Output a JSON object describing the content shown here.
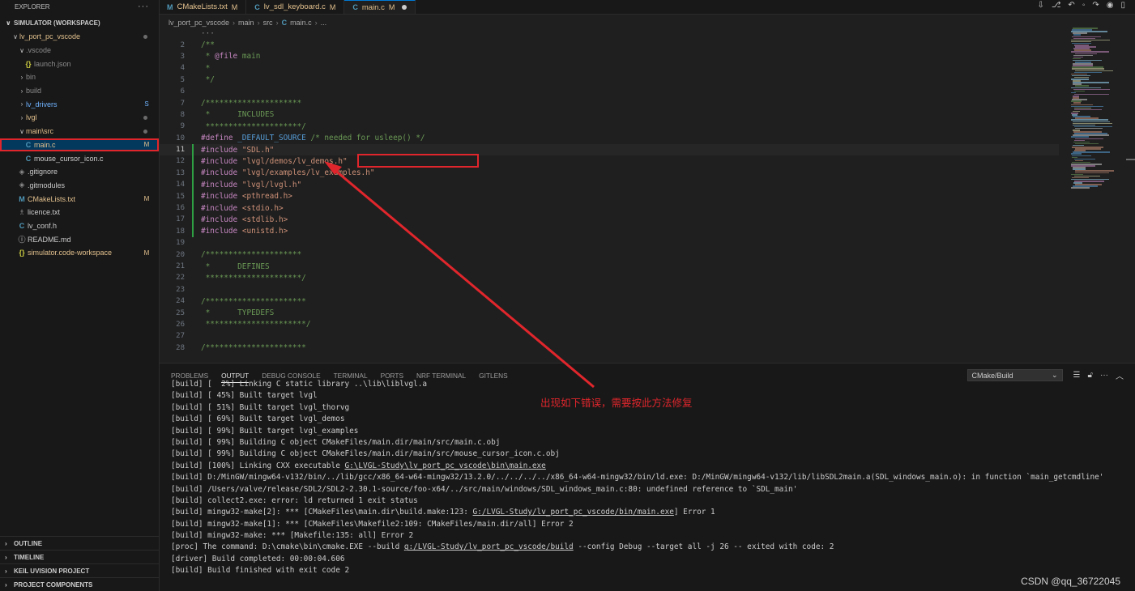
{
  "sidebar": {
    "header": "EXPLORER",
    "more": "···",
    "workspace": "SIMULATOR (WORKSPACE)",
    "items": [
      {
        "chev": "∨",
        "icon": "",
        "label": "lv_port_pc_vscode",
        "mark": "dot",
        "indent": 14
      },
      {
        "chev": "∨",
        "icon": "",
        "label": ".vscode",
        "mark": "",
        "indent": 22,
        "dim": true
      },
      {
        "chev": "",
        "icon": "{}",
        "label": "launch.json",
        "mark": "",
        "indent": 28,
        "dim": true
      },
      {
        "chev": "›",
        "icon": "",
        "label": "bin",
        "mark": "",
        "indent": 22,
        "dim": true
      },
      {
        "chev": "›",
        "icon": "",
        "label": "build",
        "mark": "",
        "indent": 22,
        "dim": true
      },
      {
        "chev": "›",
        "icon": "",
        "label": "lv_drivers",
        "mark": "S",
        "indent": 22
      },
      {
        "chev": "›",
        "icon": "",
        "label": "lvgl",
        "mark": "dot",
        "indent": 22
      },
      {
        "chev": "∨",
        "icon": "",
        "label": "main\\src",
        "mark": "dot",
        "indent": 22
      },
      {
        "chev": "",
        "icon": "C",
        "label": "main.c",
        "mark": "M",
        "indent": 28,
        "selected": true
      },
      {
        "chev": "",
        "icon": "C",
        "label": "mouse_cursor_icon.c",
        "mark": "",
        "indent": 28
      },
      {
        "chev": "",
        "icon": "◈",
        "label": ".gitignore",
        "mark": "",
        "indent": 20
      },
      {
        "chev": "",
        "icon": "◈",
        "label": ".gitmodules",
        "mark": "",
        "indent": 20
      },
      {
        "chev": "",
        "icon": "M",
        "label": "CMakeLists.txt",
        "mark": "M",
        "indent": 20
      },
      {
        "chev": "",
        "icon": "♗",
        "label": "licence.txt",
        "mark": "",
        "indent": 20
      },
      {
        "chev": "",
        "icon": "C",
        "label": "lv_conf.h",
        "mark": "",
        "indent": 20
      },
      {
        "chev": "",
        "icon": "ⓘ",
        "label": "README.md",
        "mark": "",
        "indent": 20
      },
      {
        "chev": "",
        "icon": "{}",
        "label": "simulator.code-workspace",
        "mark": "M",
        "indent": 20
      }
    ],
    "bottom_sections": [
      "OUTLINE",
      "TIMELINE",
      "KEIL UVISION PROJECT",
      "PROJECT COMPONENTS"
    ]
  },
  "tabs": [
    {
      "icon": "M",
      "label": "CMakeLists.txt",
      "badge": "M"
    },
    {
      "icon": "C",
      "label": "lv_sdl_keyboard.c",
      "badge": "M"
    },
    {
      "icon": "C",
      "label": "main.c",
      "badge": "M",
      "active": true
    }
  ],
  "breadcrumb": [
    "lv_port_pc_vscode",
    "main",
    "src",
    "main.c",
    "..."
  ],
  "code_fold": "···",
  "code_lines": [
    {
      "n": "2",
      "t": "/**",
      "c": "cm"
    },
    {
      "n": "3",
      "t": " * @file main",
      "c": "cm"
    },
    {
      "n": "4",
      "t": " *",
      "c": "cm"
    },
    {
      "n": "5",
      "t": " */",
      "c": "cm"
    },
    {
      "n": "6",
      "t": "",
      "c": ""
    },
    {
      "n": "7",
      "t": "/*********************",
      "c": "cm"
    },
    {
      "n": "8",
      "t": " *      INCLUDES",
      "c": "cm"
    },
    {
      "n": "9",
      "t": " *********************/",
      "c": "cm"
    },
    {
      "n": "10",
      "t": "#define _DEFAULT_SOURCE /* needed for usleep() */",
      "c": "define"
    },
    {
      "n": "11",
      "t": "#include \"SDL.h\"",
      "c": "inc",
      "current": true
    },
    {
      "n": "12",
      "t": "#include \"lvgl/demos/lv_demos.h\"",
      "c": "inc"
    },
    {
      "n": "13",
      "t": "#include \"lvgl/examples/lv_examples.h\"",
      "c": "inc"
    },
    {
      "n": "14",
      "t": "#include \"lvgl/lvgl.h\"",
      "c": "inc"
    },
    {
      "n": "15",
      "t": "#include <pthread.h>",
      "c": "inc"
    },
    {
      "n": "16",
      "t": "#include <stdio.h>",
      "c": "inc"
    },
    {
      "n": "17",
      "t": "#include <stdlib.h>",
      "c": "inc"
    },
    {
      "n": "18",
      "t": "#include <unistd.h>",
      "c": "inc"
    },
    {
      "n": "19",
      "t": "",
      "c": ""
    },
    {
      "n": "20",
      "t": "/*********************",
      "c": "cm"
    },
    {
      "n": "21",
      "t": " *      DEFINES",
      "c": "cm"
    },
    {
      "n": "22",
      "t": " *********************/",
      "c": "cm"
    },
    {
      "n": "23",
      "t": "",
      "c": ""
    },
    {
      "n": "24",
      "t": "/**********************",
      "c": "cm"
    },
    {
      "n": "25",
      "t": " *      TYPEDEFS",
      "c": "cm"
    },
    {
      "n": "26",
      "t": " **********************/",
      "c": "cm"
    },
    {
      "n": "27",
      "t": "",
      "c": ""
    },
    {
      "n": "28",
      "t": "/**********************",
      "c": "cm"
    }
  ],
  "panel": {
    "tabs": [
      "PROBLEMS",
      "OUTPUT",
      "DEBUG CONSOLE",
      "TERMINAL",
      "PORTS",
      "NRF TERMINAL",
      "GITLENS"
    ],
    "active_tab": "OUTPUT",
    "channel": "CMake/Build",
    "output": [
      "[build] [  2%] Linking C static library ..\\lib\\liblvgl.a",
      "[build] [ 45%] Built target lvgl",
      "[build] [ 51%] Built target lvgl_thorvg",
      "[build] [ 69%] Built target lvgl_demos",
      "[build] [ 99%] Built target lvgl_examples",
      "[build] [ 99%] Building C object CMakeFiles/main.dir/main/src/main.c.obj",
      "[build] [ 99%] Building C object CMakeFiles/main.dir/main/src/mouse_cursor_icon.c.obj",
      "[build] [100%] Linking CXX executable G:\\LVGL-Study\\lv_port_pc_vscode\\bin\\main.exe",
      "[build] D:/MinGW/mingw64-v132/bin/../lib/gcc/x86_64-w64-mingw32/13.2.0/../../../../x86_64-w64-mingw32/bin/ld.exe: D:/MinGW/mingw64-v132/lib/libSDL2main.a(SDL_windows_main.o): in function `main_getcmdline'",
      "[build] /Users/valve/release/SDL2/SDL2-2.30.1-source/foo-x64/../src/main/windows/SDL_windows_main.c:80: undefined reference to `SDL_main'",
      "[build] collect2.exe: error: ld returned 1 exit status",
      "[build] mingw32-make[2]: *** [CMakeFiles\\main.dir\\build.make:123: G:/LVGL-Study/lv_port_pc_vscode/bin/main.exe] Error 1",
      "[build] mingw32-make[1]: *** [CMakeFiles\\Makefile2:109: CMakeFiles/main.dir/all] Error 2",
      "[build] mingw32-make: *** [Makefile:135: all] Error 2",
      "[proc] The command: D:\\cmake\\bin\\cmake.EXE --build g:/LVGL-Study/lv_port_pc_vscode/build --config Debug --target all -j 26 -- exited with code: 2",
      "[driver] Build completed: 00:00:04.606",
      "[build] Build finished with exit code 2"
    ]
  },
  "annotation": "出现如下错误，需要按此方法修复",
  "watermark": "CSDN @qq_36722045",
  "colors": {
    "highlight": "#e0262c",
    "modified": "#e2c08d",
    "accent": "#0078d4"
  }
}
